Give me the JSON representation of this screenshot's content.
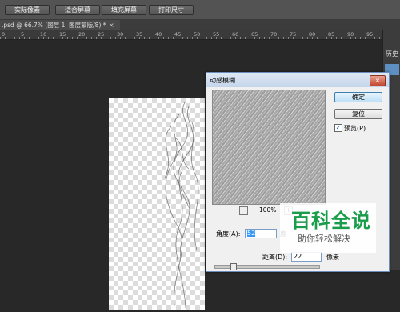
{
  "options_bar": {
    "buttons": [
      "实际像素",
      "适合屏幕",
      "填充屏幕",
      "打印尺寸"
    ]
  },
  "document_tab": {
    "label": ".psd @ 66.7% (图层 1, 图层蒙版/8) *",
    "close": "×"
  },
  "ruler": {
    "numbers": [
      "0",
      "5",
      "10",
      "15",
      "20",
      "25",
      "30",
      "35",
      "40",
      "45",
      "50",
      "55",
      "60",
      "65",
      "70",
      "75",
      "80",
      "85",
      "90",
      "95"
    ]
  },
  "right_panel": {
    "tab_label": "历史"
  },
  "dialog": {
    "title": "动感模糊",
    "close_glyph": "×",
    "ok_label": "确定",
    "reset_label": "复位",
    "preview_checkbox_checked": true,
    "preview_checkbox_mark": "✓",
    "preview_label": "预览(P)",
    "zoom_out": "−",
    "zoom_in": "+",
    "zoom_level": "100%",
    "angle_label": "角度(A):",
    "angle_value": "52",
    "angle_unit": "度",
    "distance_label": "距离(D):",
    "distance_value": "22",
    "distance_unit": "像素",
    "distance_slider_fraction": 0.15
  },
  "watermark": {
    "title": "百科全说",
    "subtitle": "助你轻松解决"
  },
  "colors": {
    "accent": "#3399ff",
    "watermark_green": "#1a9d4a"
  }
}
